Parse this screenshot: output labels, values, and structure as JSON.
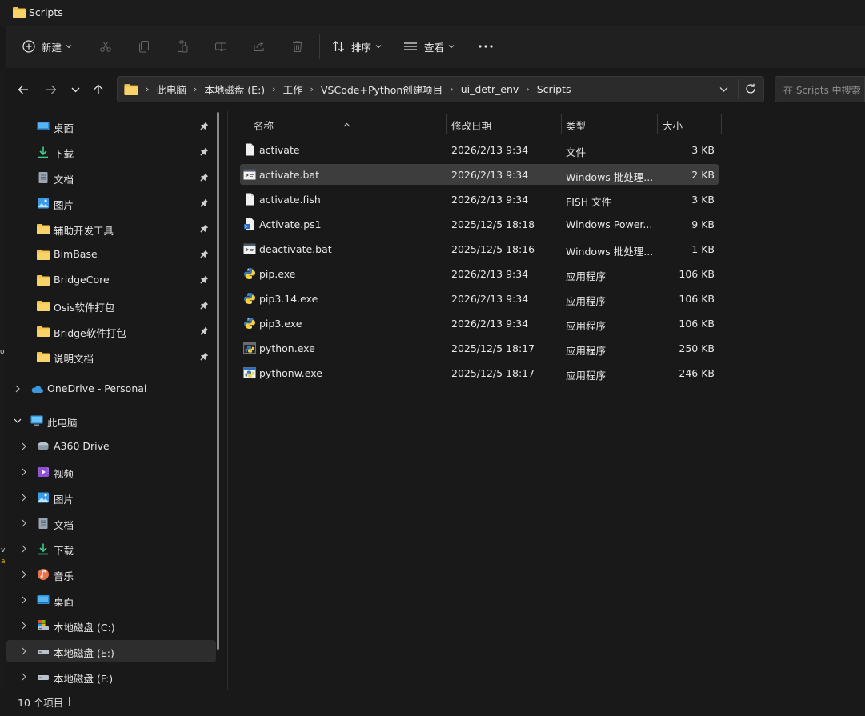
{
  "window": {
    "title": "Scripts"
  },
  "toolbar": {
    "new_label": "新建",
    "sort_label": "排序",
    "view_label": "查看"
  },
  "address": {
    "crumbs": [
      "此电脑",
      "本地磁盘 (E:)",
      "工作",
      "VSCode+Python创建项目",
      "ui_detr_env",
      "Scripts"
    ],
    "search_placeholder": "在 Scripts 中搜索"
  },
  "sidebar": {
    "quick_access": [
      {
        "label": "桌面",
        "icon": "desktop-icon"
      },
      {
        "label": "下载",
        "icon": "download-icon"
      },
      {
        "label": "文档",
        "icon": "document-icon"
      },
      {
        "label": "图片",
        "icon": "pictures-icon"
      },
      {
        "label": "辅助开发工具",
        "icon": "folder-icon"
      },
      {
        "label": "BimBase",
        "icon": "folder-icon"
      },
      {
        "label": "BridgeCore",
        "icon": "folder-icon"
      },
      {
        "label": "Osis软件打包",
        "icon": "folder-icon"
      },
      {
        "label": "Bridge软件打包",
        "icon": "folder-icon"
      },
      {
        "label": "说明文档",
        "icon": "folder-icon"
      }
    ],
    "onedrive": "OneDrive - Personal",
    "this_pc": "此电脑",
    "pc_items": [
      {
        "label": "A360 Drive",
        "icon": "network-drive-icon"
      },
      {
        "label": "视频",
        "icon": "videos-icon"
      },
      {
        "label": "图片",
        "icon": "pictures-icon"
      },
      {
        "label": "文档",
        "icon": "document-icon"
      },
      {
        "label": "下载",
        "icon": "download-icon"
      },
      {
        "label": "音乐",
        "icon": "music-icon"
      },
      {
        "label": "桌面",
        "icon": "desktop-icon"
      },
      {
        "label": "本地磁盘 (C:)",
        "icon": "system-drive-icon"
      },
      {
        "label": "本地磁盘 (E:)",
        "icon": "drive-icon"
      },
      {
        "label": "本地磁盘 (F:)",
        "icon": "drive-icon"
      }
    ]
  },
  "columns": {
    "name": "名称",
    "date": "修改日期",
    "type": "类型",
    "size": "大小"
  },
  "files": [
    {
      "name": "activate",
      "date": "2026/2/13 9:34",
      "type": "文件",
      "size": "3 KB",
      "icon": "file-icon"
    },
    {
      "name": "activate.bat",
      "date": "2026/2/13 9:34",
      "type": "Windows 批处理...",
      "size": "2 KB",
      "icon": "batch-file-icon"
    },
    {
      "name": "activate.fish",
      "date": "2026/2/13 9:34",
      "type": "FISH 文件",
      "size": "3 KB",
      "icon": "file-icon"
    },
    {
      "name": "Activate.ps1",
      "date": "2025/12/5 18:18",
      "type": "Windows Power...",
      "size": "9 KB",
      "icon": "powershell-file-icon"
    },
    {
      "name": "deactivate.bat",
      "date": "2025/12/5 18:16",
      "type": "Windows 批处理...",
      "size": "1 KB",
      "icon": "batch-file-icon"
    },
    {
      "name": "pip.exe",
      "date": "2026/2/13 9:34",
      "type": "应用程序",
      "size": "106 KB",
      "icon": "python-exe-icon"
    },
    {
      "name": "pip3.14.exe",
      "date": "2026/2/13 9:34",
      "type": "应用程序",
      "size": "106 KB",
      "icon": "python-exe-icon"
    },
    {
      "name": "pip3.exe",
      "date": "2026/2/13 9:34",
      "type": "应用程序",
      "size": "106 KB",
      "icon": "python-exe-icon"
    },
    {
      "name": "python.exe",
      "date": "2025/12/5 18:17",
      "type": "应用程序",
      "size": "250 KB",
      "icon": "python-console-icon"
    },
    {
      "name": "pythonw.exe",
      "date": "2025/12/5 18:17",
      "type": "应用程序",
      "size": "246 KB",
      "icon": "python-window-icon"
    }
  ],
  "status": {
    "item_count": "10 个项目"
  },
  "colors": {
    "folder": "#f3c445",
    "accent": "#60cdff",
    "selection": "#3d3d3d"
  }
}
